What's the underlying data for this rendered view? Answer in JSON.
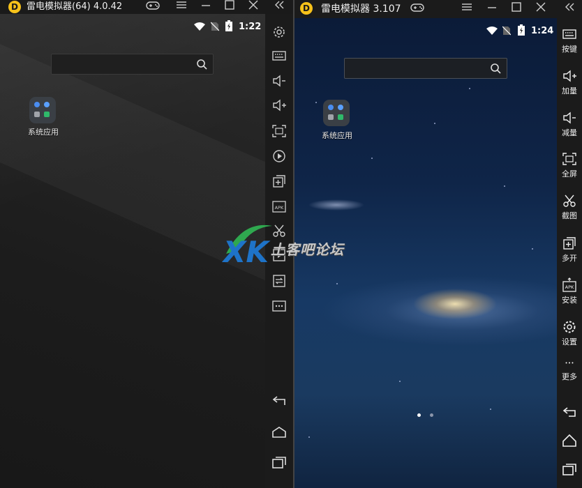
{
  "left_window": {
    "title": "雷电模拟器(64) 4.0.42",
    "logo": "leidian-logo",
    "titlebar_buttons": [
      "gamepad-icon",
      "menu-icon",
      "minimize-icon",
      "maximize-icon",
      "close-icon"
    ],
    "status": {
      "time": "1:22",
      "icons": [
        "wifi-icon",
        "no-sim-icon",
        "battery-icon"
      ]
    },
    "search": {
      "placeholder": ""
    },
    "apps": [
      {
        "label": "系统应用",
        "icon": "system-apps-folder-icon"
      }
    ],
    "toolbar": [
      "collapse-icon",
      "settings-gear-icon",
      "keyboard-icon",
      "volume-down-icon",
      "volume-up-icon",
      "fullscreen-icon",
      "record-icon",
      "multi-instance-icon",
      "apk-install-icon",
      "screenshot-scissors-icon",
      "video-icon",
      "sync-icon",
      "more-icon",
      "back-icon",
      "home-icon",
      "recent-apps-icon"
    ]
  },
  "right_window": {
    "title": "雷电模拟器 3.107",
    "logo": "leidian-logo",
    "titlebar_buttons": [
      "gamepad-icon",
      "menu-icon",
      "minimize-icon",
      "maximize-icon",
      "close-icon"
    ],
    "status": {
      "time": "1:24",
      "icons": [
        "wifi-icon",
        "no-sim-icon",
        "battery-icon"
      ]
    },
    "search": {
      "placeholder": ""
    },
    "apps": [
      {
        "label": "系统应用",
        "icon": "system-apps-folder-icon"
      }
    ],
    "pagination": {
      "count": 2,
      "active": 1
    },
    "toolbar": [
      {
        "icon": "keyboard-icon",
        "label": "按键"
      },
      {
        "icon": "volume-up-icon",
        "label": "加量"
      },
      {
        "icon": "volume-down-icon",
        "label": "减量"
      },
      {
        "icon": "fullscreen-icon",
        "label": "全屏"
      },
      {
        "icon": "screenshot-scissors-icon",
        "label": "截图"
      },
      {
        "icon": "multi-instance-icon",
        "label": "多开"
      },
      {
        "icon": "apk-install-icon",
        "label": "安装"
      },
      {
        "icon": "settings-gear-icon",
        "label": "设置"
      },
      {
        "icon": "more-icon",
        "label": "更多"
      }
    ],
    "nav": [
      "back-icon",
      "home-icon",
      "recent-apps-icon"
    ]
  },
  "watermark": {
    "text": "土客吧论坛",
    "logo": "xk-logo"
  },
  "colors": {
    "logo": "#f7c21a",
    "titlebar": "#1a1a1a",
    "sidebar": "#1b1b1b",
    "page_dot_active": "#ffffff",
    "page_dot_inactive": "#8a95aa"
  }
}
